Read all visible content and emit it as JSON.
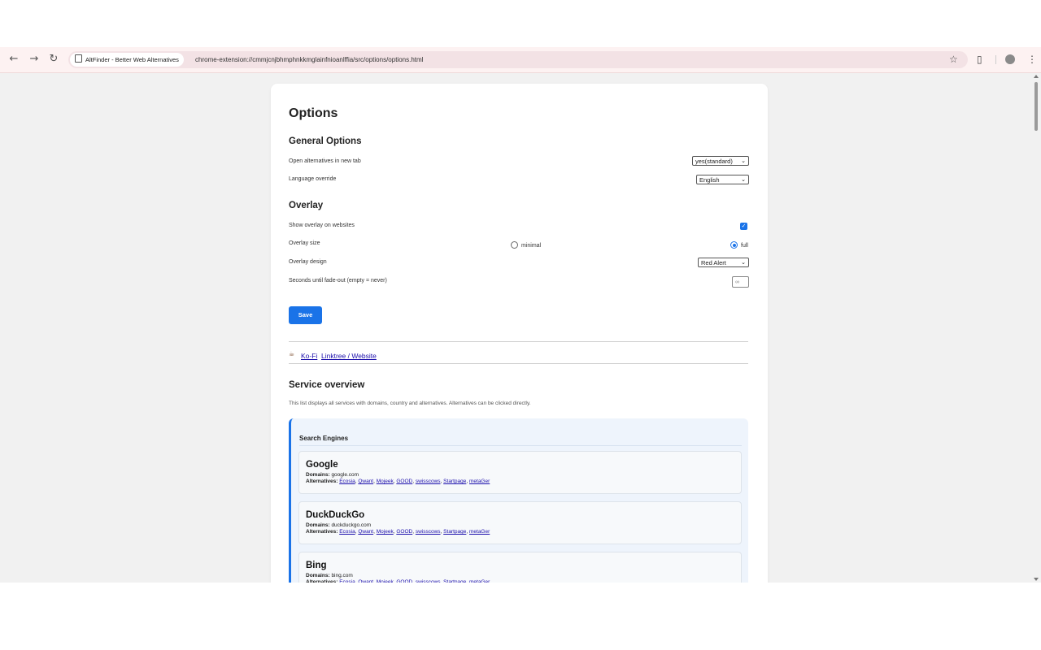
{
  "browser": {
    "tab_title": "AltFinder - Better Web Alternatives",
    "url": "chrome-extension://cmmjcnjbhmphnkkmglainfnioanlffia/src/options/options.html",
    "icons": {
      "back": "back-arrow-icon",
      "forward": "forward-arrow-icon",
      "reload": "reload-icon",
      "bookmark": "star-icon",
      "extensions": "puzzle-icon",
      "menu": "more-vert-icon"
    }
  },
  "page": {
    "title": "Options",
    "general": {
      "heading": "General Options",
      "open_new_tab_label": "Open alternatives in new tab",
      "open_new_tab_value": "yes(standard)",
      "language_label": "Language override",
      "language_value": "English"
    },
    "overlay": {
      "heading": "Overlay",
      "show_label": "Show overlay on websites",
      "show_checked": true,
      "size_label": "Overlay size",
      "size_option_minimal": "minimal",
      "size_option_full": "full",
      "size_selected": "full",
      "design_label": "Overlay design",
      "design_value": "Red Alert",
      "fadeout_label": "Seconds until fade-out (empty = never)",
      "fadeout_value": "∞"
    },
    "save_label": "Save",
    "links": {
      "kofi": "Ko-Fi",
      "linktree": "Linktree / Website"
    },
    "service_overview": {
      "heading": "Service overview",
      "description": "This list displays all services with domains, country and alternatives. Alternatives can be clicked directly.",
      "domains_label": "Domains:",
      "alternatives_label": "Alternatives:",
      "categories": [
        {
          "name": "Search Engines",
          "services": [
            {
              "name": "Google",
              "domains": "google.com",
              "alternatives": [
                "Ecosia",
                "Qwant",
                "Mojeek",
                "GOOD",
                "swisscows",
                "Startpage",
                "metaGer"
              ]
            },
            {
              "name": "DuckDuckGo",
              "domains": "duckduckgo.com",
              "alternatives": [
                "Ecosia",
                "Qwant",
                "Mojeek",
                "GOOD",
                "swisscows",
                "Startpage",
                "metaGer"
              ]
            },
            {
              "name": "Bing",
              "domains": "bing.com",
              "alternatives": [
                "Ecosia",
                "Qwant",
                "Mojeek",
                "GOOD",
                "swisscows",
                "Startpage",
                "metaGer"
              ]
            }
          ]
        }
      ]
    }
  },
  "colors": {
    "accent": "#1a73e8",
    "link": "#1a0dab",
    "category_bg": "#eef4fc"
  }
}
